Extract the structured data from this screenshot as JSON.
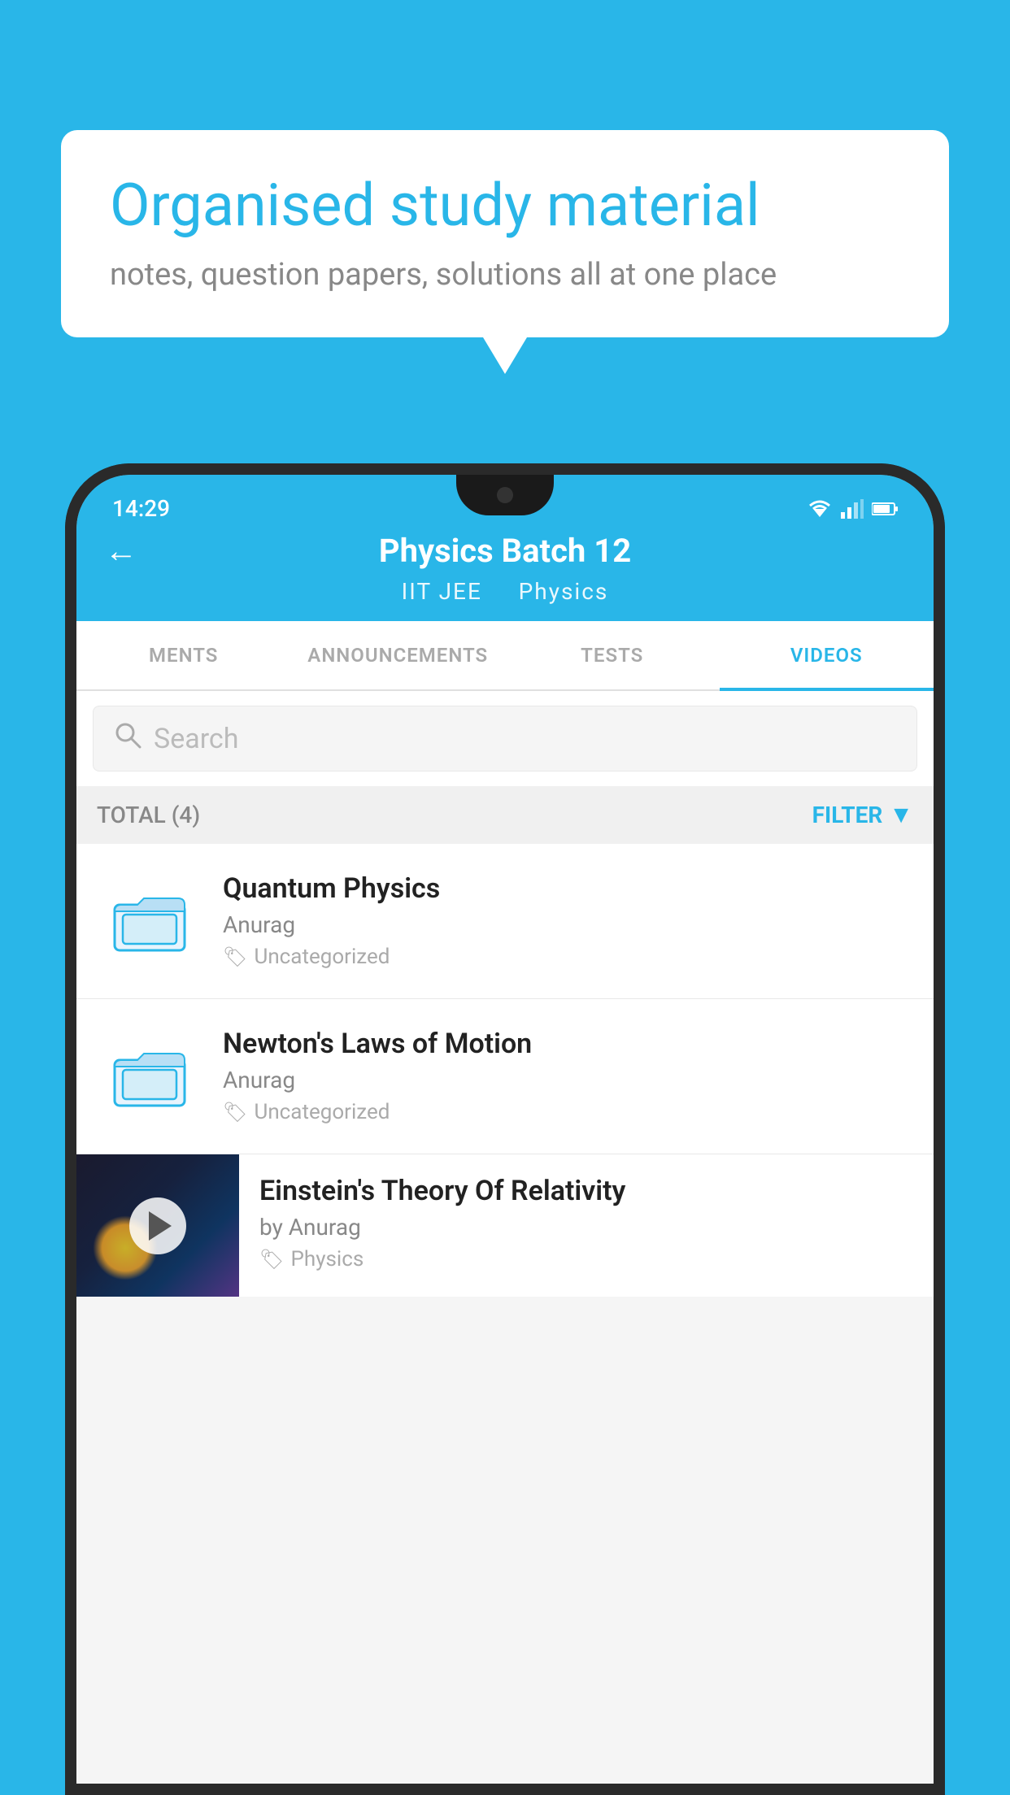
{
  "background": {
    "color": "#29b6e8"
  },
  "bubble": {
    "title": "Organised study material",
    "subtitle": "notes, question papers, solutions all at one place"
  },
  "status_bar": {
    "time": "14:29",
    "icons": [
      "wifi",
      "signal",
      "battery"
    ]
  },
  "header": {
    "title": "Physics Batch 12",
    "subtitle_left": "IIT JEE",
    "subtitle_right": "Physics",
    "back_label": "←"
  },
  "tabs": [
    {
      "label": "MENTS",
      "active": false
    },
    {
      "label": "ANNOUNCEMENTS",
      "active": false
    },
    {
      "label": "TESTS",
      "active": false
    },
    {
      "label": "VIDEOS",
      "active": true
    }
  ],
  "search": {
    "placeholder": "Search"
  },
  "filter": {
    "total_label": "TOTAL (4)",
    "filter_label": "FILTER"
  },
  "videos": [
    {
      "title": "Quantum Physics",
      "author": "Anurag",
      "tag": "Uncategorized",
      "type": "folder"
    },
    {
      "title": "Newton's Laws of Motion",
      "author": "Anurag",
      "tag": "Uncategorized",
      "type": "folder"
    },
    {
      "title": "Einstein's Theory Of Relativity",
      "author": "by Anurag",
      "tag": "Physics",
      "type": "video"
    }
  ]
}
